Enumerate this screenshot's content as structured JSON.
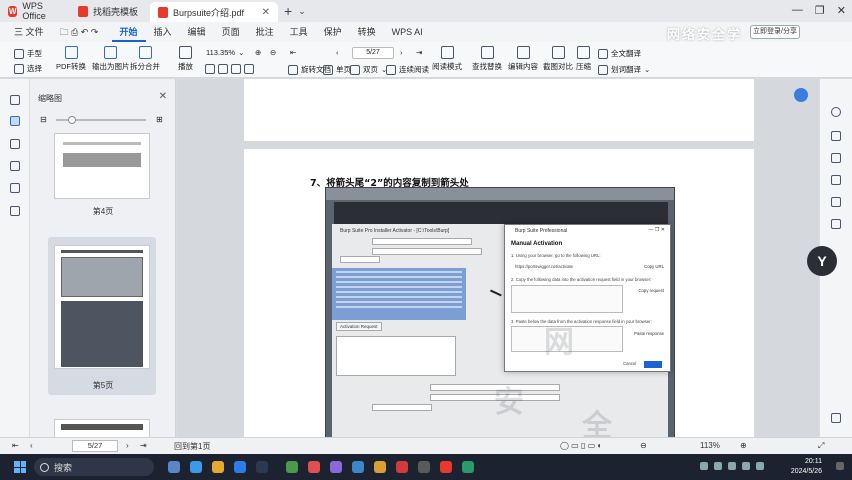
{
  "titlebar": {
    "home_tab": "WPS Office",
    "template_tab": "找稻壳模板",
    "doc_tab": "Burpsuite介绍.pdf"
  },
  "menu": {
    "file": "三 文件",
    "items": [
      "开始",
      "插入",
      "编辑",
      "页面",
      "批注",
      "工具",
      "保护",
      "转换",
      "WPS AI"
    ],
    "active": "开始",
    "share": "立即登录/分享"
  },
  "watermark_top": "网络安全学",
  "ribbon": {
    "hand": "手型",
    "select": "选择",
    "pdf_convert": "PDF转换",
    "export_image": "输出为图片",
    "split_merge": "拆分合并",
    "play": "播放",
    "zoom": "113.35%",
    "page_indicator": "5/27",
    "rotate": "旋转文档",
    "single": "单页",
    "double": "双页",
    "continuous": "连续阅读",
    "read_mode": "阅读模式",
    "find_replace": "查找替换",
    "edit_content": "编辑内容",
    "screenshot_compare": "截图对比",
    "compress": "压缩",
    "full_translate": "全文翻译",
    "word_translate": "划词翻译"
  },
  "thumbs": {
    "title": "缩略图",
    "page4": "第4页",
    "page5": "第5页"
  },
  "document": {
    "step_text": "7、将箭头尾“2”的内容复制到箭头处",
    "burp_window_title": "Burp Suite Pro Installer Activator - [C:\\Tools\\Burp]",
    "burp_tab_text": "Activation Request",
    "dialog": {
      "title": "Burp Suite Professional",
      "heading": "Manual Activation",
      "line1": "1. Using your browser, go to the following URL:",
      "url": "https://portswigger.net/activate",
      "copy_url": "Copy URL",
      "line2": "2. Copy the following data into the activation request field in your browser:",
      "copy_request": "Copy request",
      "line3": "3. Paste below the data from the activation response field in your browser:",
      "paste": "Paste response",
      "cancel": "Cancel",
      "next": "Next"
    },
    "watermark_main": "网",
    "watermark_main2": "安",
    "watermark_main3": "全"
  },
  "statusbar": {
    "page_input": "5/27",
    "back_to_first": "回到第1页",
    "zoom": "113%"
  },
  "taskbar": {
    "search": "搜索",
    "time": "20:11",
    "date": "2024/5/26"
  }
}
